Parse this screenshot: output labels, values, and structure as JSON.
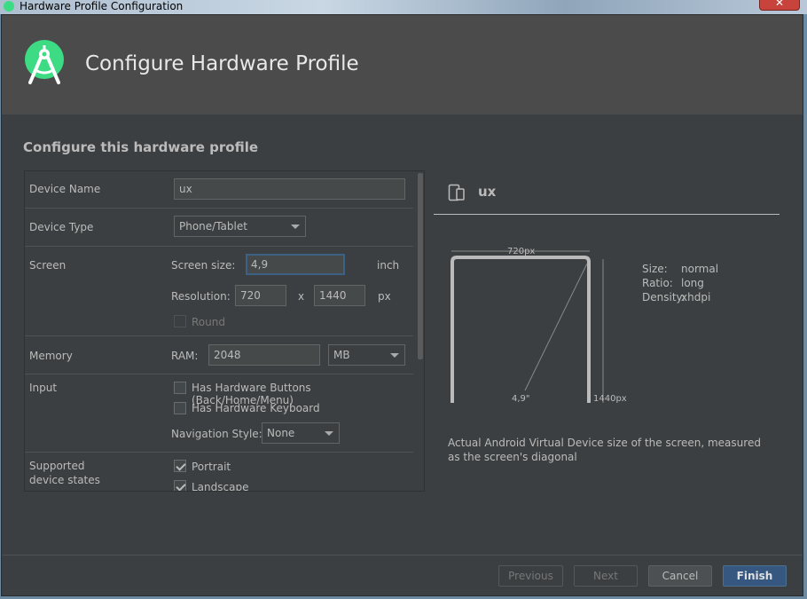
{
  "window": {
    "title": "Hardware Profile Configuration",
    "close_label": "✕"
  },
  "header": {
    "title": "Configure Hardware Profile"
  },
  "section_title": "Configure this hardware profile",
  "form": {
    "device_name": {
      "label": "Device Name",
      "value": "ux"
    },
    "device_type": {
      "label": "Device Type",
      "value": "Phone/Tablet"
    },
    "screen": {
      "label": "Screen",
      "size_label": "Screen size:",
      "size_value": "4,9",
      "size_unit": "inch",
      "resolution_label": "Resolution:",
      "res_width": "720",
      "res_x": "x",
      "res_height": "1440",
      "res_unit": "px",
      "round_label": "Round"
    },
    "memory": {
      "label": "Memory",
      "ram_label": "RAM:",
      "ram_value": "2048",
      "ram_unit": "MB"
    },
    "input": {
      "label": "Input",
      "hw_buttons_label": "Has Hardware Buttons (Back/Home/Menu)",
      "hw_keyboard_label": "Has Hardware Keyboard",
      "nav_style_label": "Navigation Style:",
      "nav_style_value": "None"
    },
    "states": {
      "label_line1": "Supported",
      "label_line2": "device states",
      "portrait_label": "Portrait",
      "landscape_label": "Landscape"
    }
  },
  "preview": {
    "name": "ux",
    "width_px": "720px",
    "height_px": "1440px",
    "diagonal": "4,9\"",
    "size_key": "Size:",
    "size_val": "normal",
    "ratio_key": "Ratio:",
    "ratio_val": "long",
    "density_key": "Density:",
    "density_val": "xhdpi",
    "caption": "Actual Android Virtual Device size of the screen, measured as the screen's diagonal"
  },
  "buttons": {
    "previous": "Previous",
    "next": "Next",
    "cancel": "Cancel",
    "finish": "Finish"
  },
  "colors": {
    "accent": "#365880",
    "android_green": "#3ddc84",
    "background": "#3c3f41"
  }
}
